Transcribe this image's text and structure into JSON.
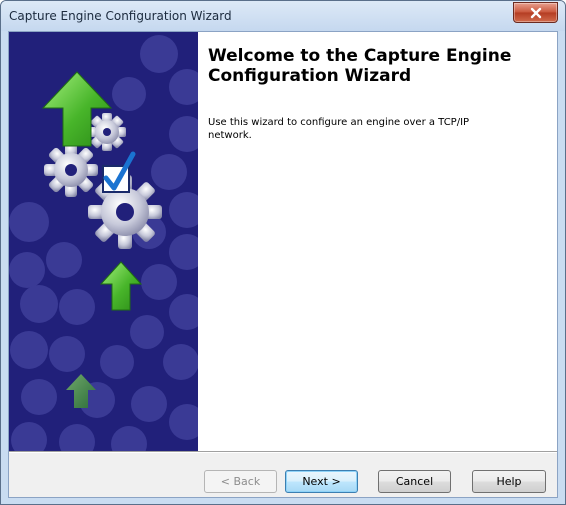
{
  "window": {
    "title": "Capture Engine Configuration Wizard"
  },
  "page": {
    "heading": "Welcome to the Capture Engine Configuration Wizard",
    "description": "Use this wizard to configure an engine over a TCP/IP network."
  },
  "sidebar": {
    "icons": [
      "arrow-up-icon",
      "gears-icon",
      "checkmark-icon"
    ]
  },
  "buttons": {
    "back": "< Back",
    "next": "Next >",
    "cancel": "Cancel",
    "help": "Help"
  },
  "colors": {
    "sidebar_background": "#21207a",
    "sidebar_circles": "#3a3a95",
    "arrow_green": "#5cc93a",
    "checkmark_blue": "#1a73d1",
    "close_button": "#c9553a"
  }
}
